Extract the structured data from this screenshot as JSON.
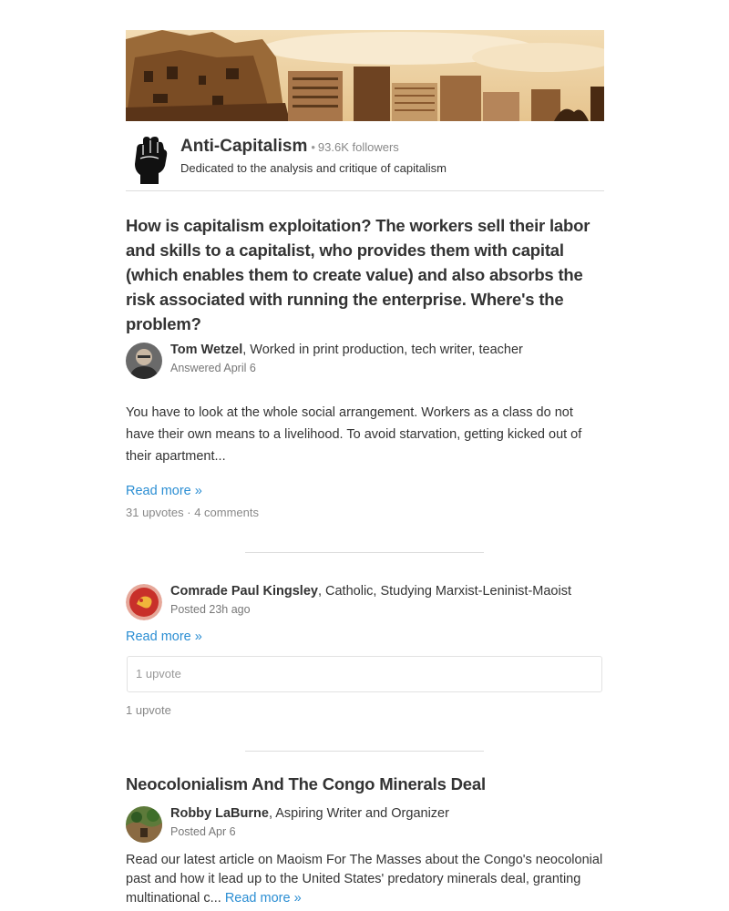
{
  "space": {
    "name": "Anti-Capitalism",
    "separator": "•",
    "followers": "93.6K followers",
    "description": "Dedicated to the analysis and critique of capitalism"
  },
  "question": {
    "text": "How is capitalism exploitation? The workers sell their labor and skills to a capitalist, who provides them with capital (which enables them to create value) and also absorbs the risk associated with running the enterprise. Where's the problem?",
    "author_name": "Tom Wetzel",
    "author_cred": ", Worked in print production, tech writer, teacher",
    "date": "Answered April 6",
    "excerpt": "You have to look at the whole social arrangement. Workers as a class do not have their own means to a livelihood. To avoid starvation, getting kicked out of their apartment...",
    "read_more": "Read more »",
    "upvotes": "31 upvotes",
    "meta_sep": "·",
    "comments": "4 comments"
  },
  "post2": {
    "author_name": "Comrade Paul Kingsley",
    "author_cred": ", Catholic, Studying Marxist-Leninist-Maoist",
    "date": "Posted 23h ago",
    "read_more": "Read more »",
    "box_upvote": "1 upvote",
    "upvotes": "1 upvote"
  },
  "post3": {
    "title": "Neocolonialism And The Congo Minerals Deal",
    "author_name": "Robby LaBurne",
    "author_cred": ", Aspiring Writer and Organizer",
    "date": "Posted Apr 6",
    "excerpt": "Read our latest article on Maoism For The Masses about the Congo's neocolonial past and how it lead up to the United States' predatory minerals deal, granting multinational c...",
    "read_more": "Read more »"
  },
  "colors": {
    "link": "#2b8ed3",
    "text": "#333333",
    "muted": "#888888",
    "divider": "#dddddd",
    "banner_tint": "#c8a06a"
  }
}
